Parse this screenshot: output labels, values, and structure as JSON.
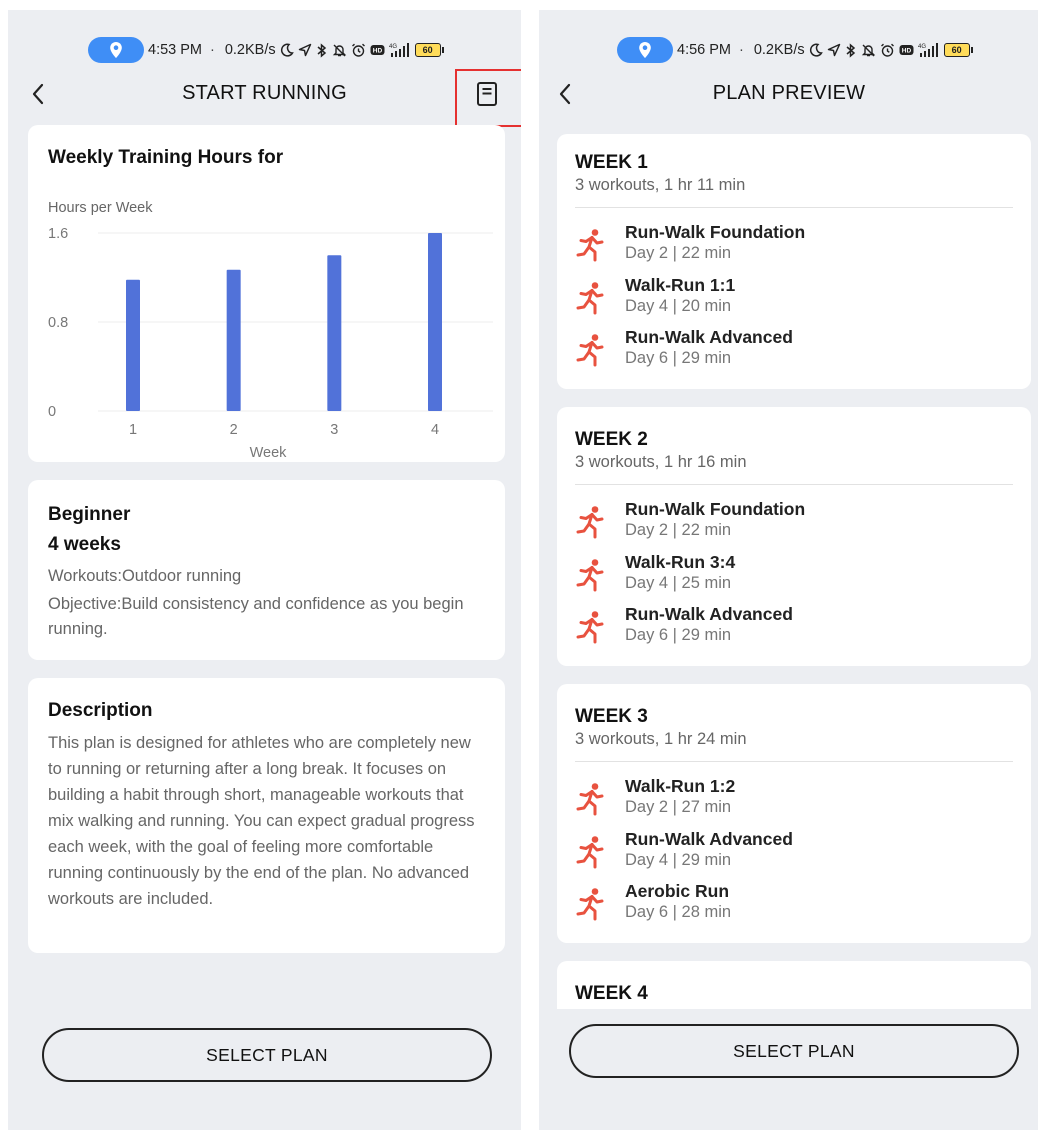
{
  "status_left": {
    "time": "4:53 PM",
    "separator": "·",
    "speed": "0.2KB/s",
    "network": "4G",
    "battery": "60"
  },
  "status_right": {
    "time": "4:56 PM",
    "separator": "·",
    "speed": "0.2KB/s",
    "network": "4G",
    "battery": "60"
  },
  "colors": {
    "accent_bar": "#5172d9",
    "run_icon": "#e8523f",
    "highlight": "#e53030",
    "location_pill": "#3f8ef6"
  },
  "start_running": {
    "title": "START RUNNING",
    "chart_card": {
      "title": "Weekly Training Hours for",
      "chart_data": {
        "type": "bar",
        "title": "Weekly Training Hours for",
        "ylabel": "Hours per Week",
        "xlabel": "Week",
        "categories": [
          "1",
          "2",
          "3",
          "4"
        ],
        "values": [
          1.18,
          1.27,
          1.4,
          1.6
        ],
        "ylim": [
          0,
          1.6
        ],
        "yticks": [
          "0",
          "0.8",
          "1.6"
        ],
        "grid": true
      }
    },
    "summary": {
      "level": "Beginner",
      "weeks": "4 weeks",
      "workouts": "Workouts:Outdoor running",
      "objective": "Objective:Build consistency and confidence as you begin running."
    },
    "description": {
      "title": "Description",
      "text": "This plan is designed for athletes who are completely new to running or returning after a long break. It focuses on building a habit through short, manageable workouts that mix walking and running. You can expect gradual progress each week, with the goal of feeling more comfortable running continuously by the end of the plan. No advanced workouts are included."
    },
    "select_label": "SELECT PLAN"
  },
  "plan_preview": {
    "title": "PLAN PREVIEW",
    "weeks": [
      {
        "title": "WEEK 1",
        "summary": "3 workouts, 1 hr 11 min",
        "workouts": [
          {
            "name": "Run-Walk Foundation",
            "meta": "Day 2 | 22 min"
          },
          {
            "name": "Walk-Run 1:1",
            "meta": "Day 4 | 20 min"
          },
          {
            "name": "Run-Walk Advanced",
            "meta": "Day 6 | 29 min"
          }
        ]
      },
      {
        "title": "WEEK 2",
        "summary": "3 workouts, 1 hr 16 min",
        "workouts": [
          {
            "name": "Run-Walk Foundation",
            "meta": "Day 2 | 22 min"
          },
          {
            "name": "Walk-Run 3:4",
            "meta": "Day 4 | 25 min"
          },
          {
            "name": "Run-Walk Advanced",
            "meta": "Day 6 | 29 min"
          }
        ]
      },
      {
        "title": "WEEK 3",
        "summary": "3 workouts, 1 hr 24 min",
        "workouts": [
          {
            "name": "Walk-Run 1:2",
            "meta": "Day 2 | 27 min"
          },
          {
            "name": "Run-Walk Advanced",
            "meta": "Day 4 | 29 min"
          },
          {
            "name": "Aerobic Run",
            "meta": "Day 6 | 28 min"
          }
        ]
      },
      {
        "title": "WEEK 4"
      }
    ],
    "select_label": "SELECT PLAN"
  }
}
